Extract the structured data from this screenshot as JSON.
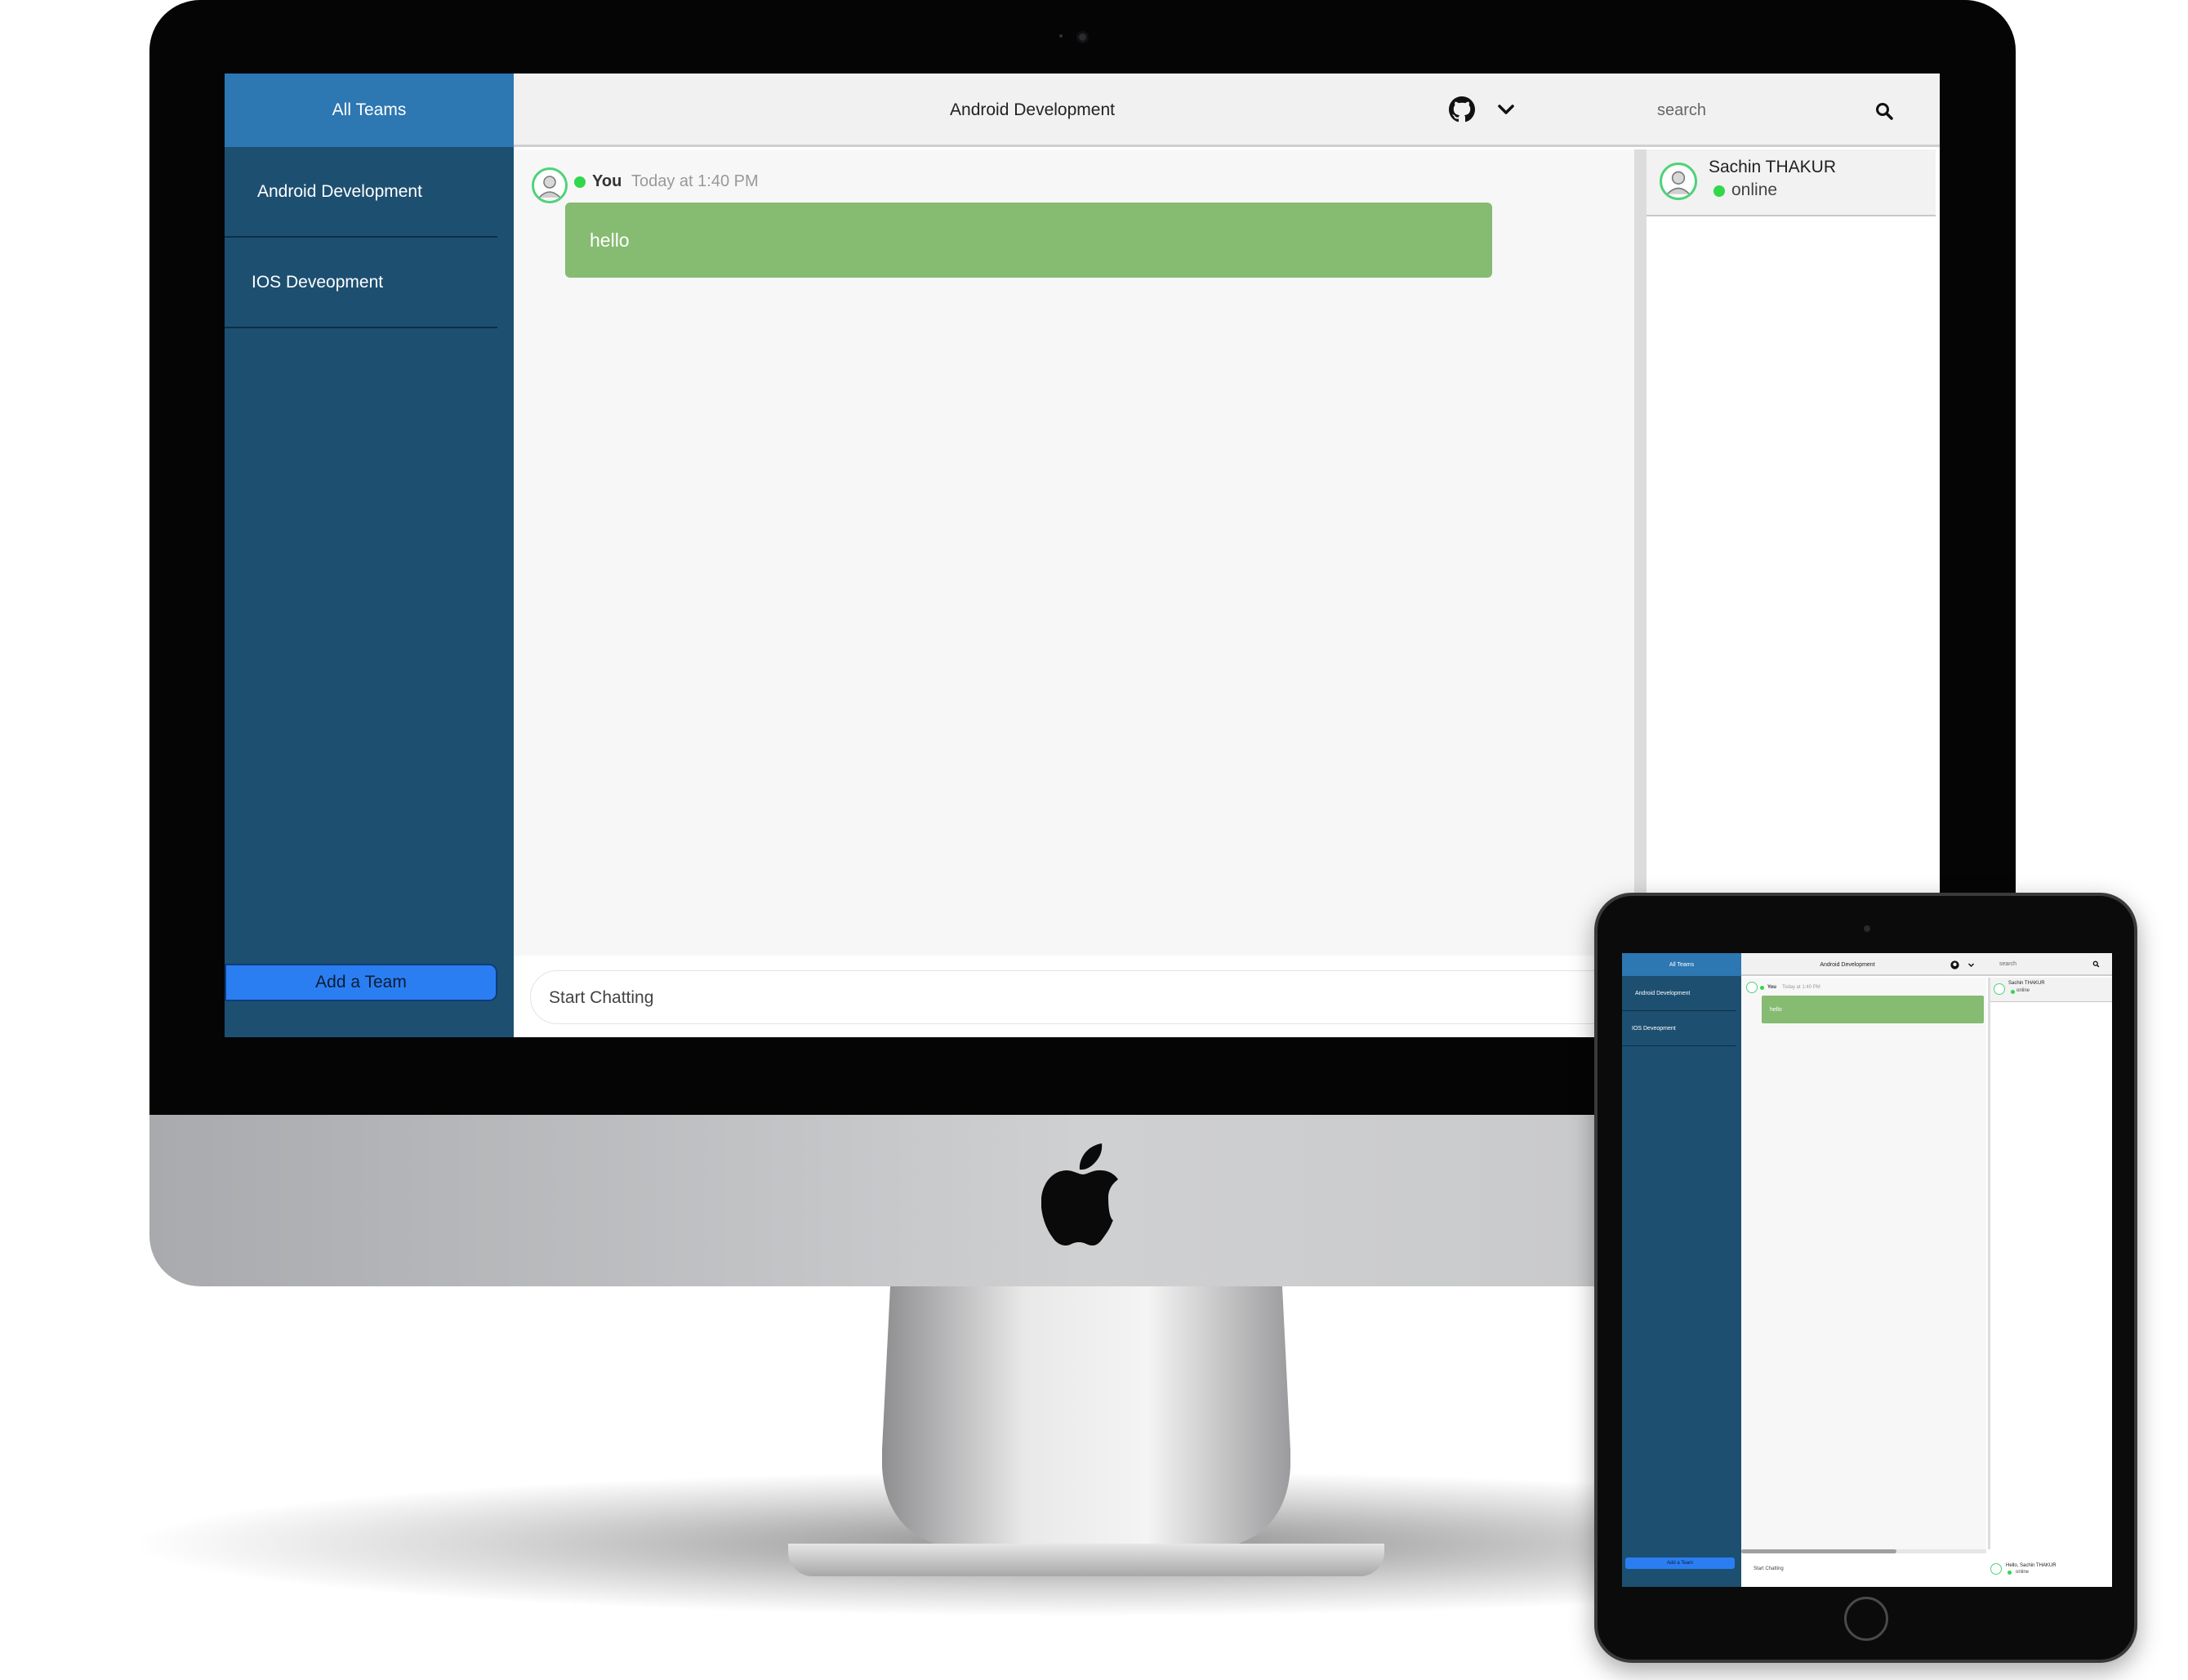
{
  "sidebar": {
    "header": "All Teams",
    "teams": [
      {
        "label": "Android Development"
      },
      {
        "label": "IOS Deveopment"
      }
    ],
    "add_button": "Add a Team"
  },
  "topbar": {
    "channel_title": "Android Development",
    "search_placeholder": "search"
  },
  "chat": {
    "messages": [
      {
        "author": "You",
        "time": "Today at 1:40 PM",
        "text": "hello"
      }
    ],
    "composer_placeholder": "Start Chatting"
  },
  "members": [
    {
      "name": "Sachin THAKUR",
      "status": "online"
    }
  ],
  "footer_user": {
    "greeting": "Hello, Sachin THAKUR",
    "status": "online"
  },
  "colors": {
    "sidebar_bg": "#1d4f71",
    "header_blue": "#2d77b2",
    "add_button": "#2b7ef2",
    "bubble_green": "#86bb72",
    "online_green": "#32d74b"
  },
  "icons": [
    "github-icon",
    "chevron-down-icon",
    "search-icon",
    "avatar-icon",
    "apple-logo"
  ]
}
